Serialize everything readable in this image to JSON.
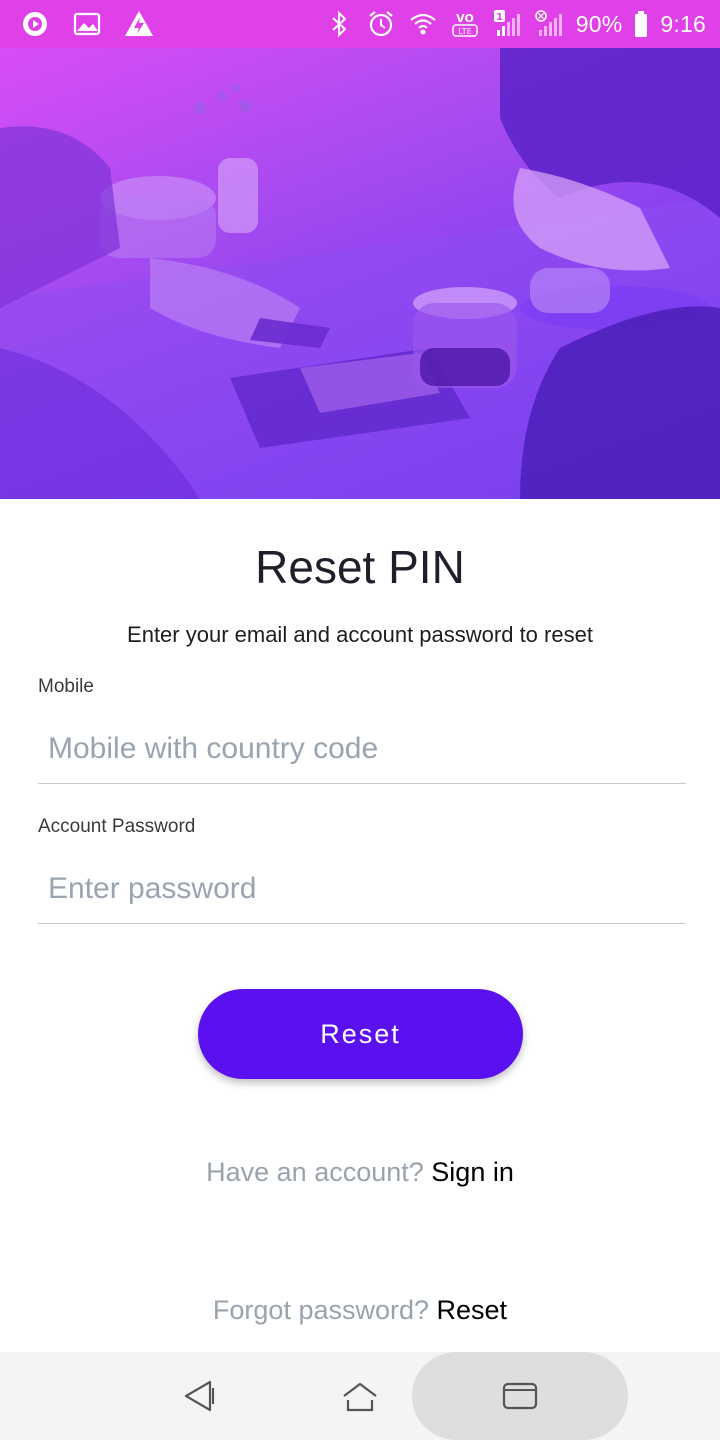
{
  "status_bar": {
    "battery": "90%",
    "time": "9:16",
    "left_icons": [
      "media-play-icon",
      "image-icon",
      "flash-app-icon"
    ],
    "right_icons": [
      "bluetooth-icon",
      "alarm-icon",
      "wifi-icon",
      "volte-icon",
      "signal-icon",
      "signal-no-sim-icon",
      "battery-icon"
    ]
  },
  "page": {
    "title": "Reset PIN",
    "subtitle": "Enter your email and account password to reset"
  },
  "form": {
    "mobile": {
      "label": "Mobile",
      "placeholder": "Mobile with country code",
      "value": ""
    },
    "password": {
      "label": "Account Password",
      "placeholder": "Enter password",
      "value": ""
    },
    "submit_label": "Reset"
  },
  "links": {
    "signin_prompt": "Have an account?",
    "signin_label": "Sign in",
    "forgot_prompt": "Forgot password?",
    "forgot_label": "Reset"
  },
  "colors": {
    "status_bar": "#e040e8",
    "hero_gradient_start": "#d94cf5",
    "hero_gradient_end": "#5a2ee6",
    "button": "#5b10f0",
    "muted_text": "#9aa3ad"
  }
}
